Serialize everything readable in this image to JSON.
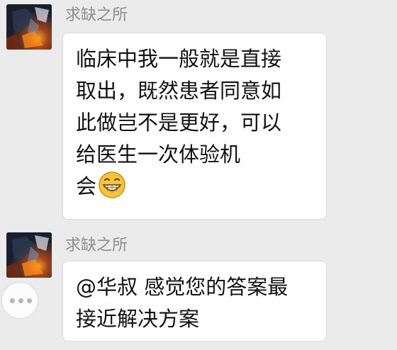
{
  "messages": [
    {
      "sender": "求缺之所",
      "avatar_icon": "dark-fantasy-avatar",
      "lines": [
        "临床中我一般就是直接",
        "取出，既然患者同意如",
        "此做岂不是更好，可以",
        "给医生一次体验机",
        "会"
      ],
      "emoji": "grinning-face-emoji"
    },
    {
      "sender": "求缺之所",
      "avatar_icon": "dark-fantasy-avatar",
      "lines": [
        "@华叔 感觉您的答案最",
        "接近解决方案"
      ]
    }
  ],
  "more_button_icon": "ellipsis-icon",
  "colors": {
    "background": "#ebebeb",
    "bubble": "#ffffff",
    "sender_text": "#8e8e8e",
    "message_text": "#111111",
    "emoji_face": "#f6c33a"
  }
}
